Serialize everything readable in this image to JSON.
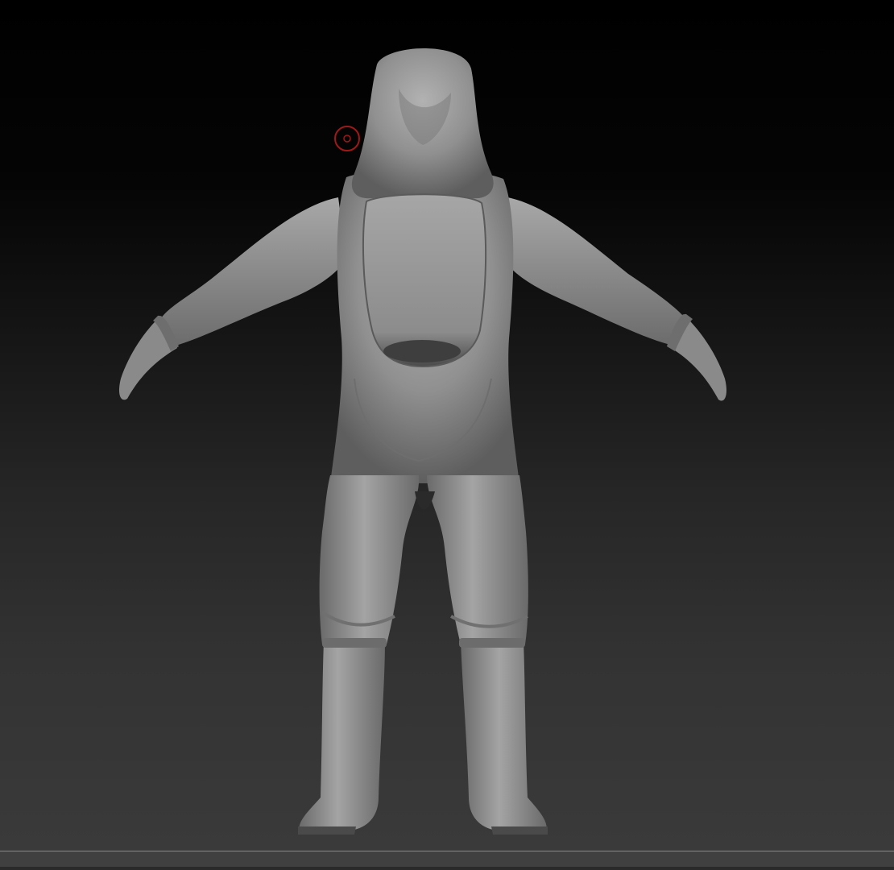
{
  "viewport": {
    "tool": "sculpt-viewport",
    "model": "hazmat-suit-back-view",
    "background": {
      "top": "#000000",
      "bottom": "#3a3a3a"
    },
    "material_color": "#8f8f8f",
    "cursor": {
      "icon": "brush-cursor-icon",
      "color": "#a01818"
    }
  }
}
